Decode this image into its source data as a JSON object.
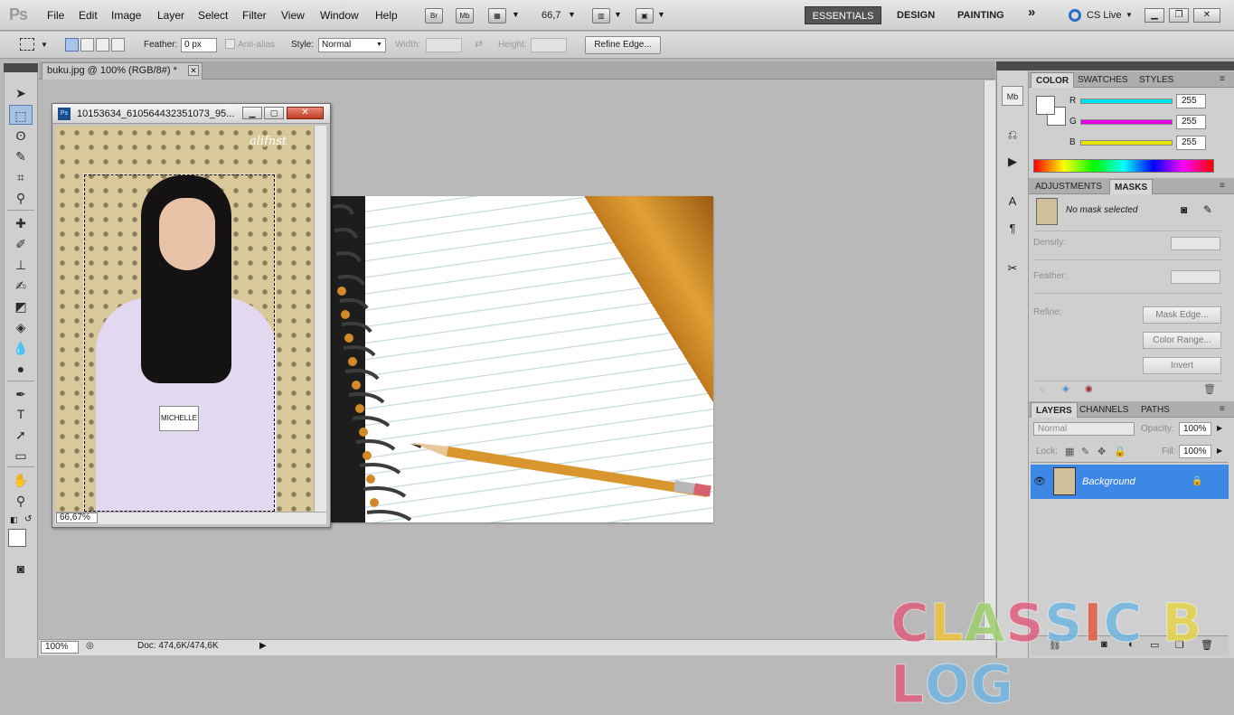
{
  "app": {
    "logo": "Ps"
  },
  "menu": [
    "File",
    "Edit",
    "Image",
    "Layer",
    "Select",
    "Filter",
    "View",
    "Window",
    "Help"
  ],
  "appbar": {
    "br": "Br",
    "mb": "Mb",
    "zoom": "66,7"
  },
  "workspaces": {
    "essentials": "ESSENTIALS",
    "design": "DESIGN",
    "painting": "PAINTING",
    "more": "»",
    "cs_live": "CS Live"
  },
  "options": {
    "feather_label": "Feather:",
    "feather_value": "0 px",
    "antialias": "Anti-alias",
    "style_label": "Style:",
    "style_value": "Normal",
    "width_label": "Width:",
    "height_label": "Height:",
    "refine_edge": "Refine Edge..."
  },
  "document": {
    "tab": "buku.jpg @ 100% (RGB/8#) *",
    "zoom": "100%",
    "doc_size": "Doc: 474,6K/474,6K"
  },
  "float_window": {
    "title": "10153634_610564432351073_95...",
    "zoom": "66,67%",
    "name_tag": "MICHELLE",
    "watermark": "alifnst"
  },
  "color_panel": {
    "tabs": [
      "COLOR",
      "SWATCHES",
      "STYLES"
    ],
    "channels": [
      {
        "label": "R",
        "value": "255",
        "color": "#00e6e6"
      },
      {
        "label": "G",
        "value": "255",
        "color": "#e600e6"
      },
      {
        "label": "B",
        "value": "255",
        "color": "#e6e600"
      }
    ]
  },
  "masks_panel": {
    "tabs": [
      "ADJUSTMENTS",
      "MASKS"
    ],
    "status": "No mask selected",
    "density": "Density:",
    "feather": "Feather:",
    "refine": "Refine:",
    "buttons": [
      "Mask Edge...",
      "Color Range...",
      "Invert"
    ]
  },
  "layers_panel": {
    "tabs": [
      "LAYERS",
      "CHANNELS",
      "PATHS"
    ],
    "blend": "Normal",
    "opacity_label": "Opacity:",
    "opacity": "100%",
    "lock_label": "Lock:",
    "fill_label": "Fill:",
    "fill": "100%",
    "layer_name": "Background"
  },
  "watermark_logo": [
    "C",
    "L",
    "A",
    "S",
    "S",
    "I",
    "C",
    " ",
    "B",
    "L",
    "O",
    "G"
  ],
  "colors": {
    "accent": "#3d87e6",
    "logo": [
      "#e05a7a",
      "#f0c23a",
      "#9ccf6a",
      "#e05a7a",
      "#6fb5e3",
      "#e0583f",
      "#6fb5e3",
      "#ffffff",
      "#e6d545",
      "#e05a7a",
      "#6fb5e3",
      "#6fb5e3"
    ]
  }
}
